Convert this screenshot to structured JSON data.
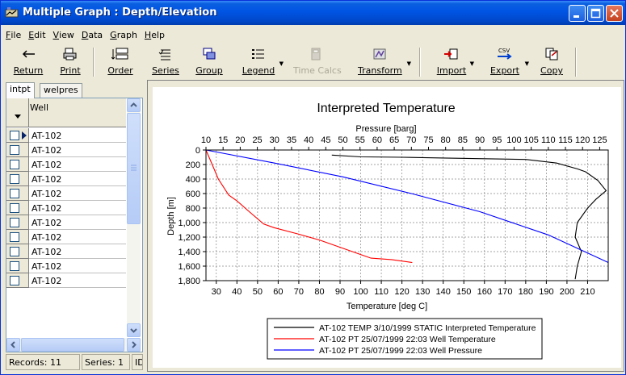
{
  "window": {
    "title": "Multiple Graph : Depth/Elevation"
  },
  "menu": [
    {
      "key": "F",
      "rest": "ile"
    },
    {
      "key": "E",
      "rest": "dit"
    },
    {
      "key": "V",
      "rest": "iew"
    },
    {
      "key": "D",
      "rest": "ata"
    },
    {
      "key": "G",
      "rest": "raph"
    },
    {
      "key": "H",
      "rest": "elp"
    }
  ],
  "toolbar": {
    "return": "Return",
    "print": "Print",
    "order": "Order",
    "series": "Series",
    "group": "Group",
    "legend": "Legend",
    "time_calcs": "Time Calcs",
    "transform": "Transform",
    "import": "Import",
    "export": "Export",
    "copy": "Copy",
    "export_badge": "CSV"
  },
  "tabs": [
    "intpt",
    "welpres"
  ],
  "grid": {
    "column_header": "Well",
    "rows": [
      "AT-102",
      "AT-102",
      "AT-102",
      "AT-102",
      "AT-102",
      "AT-102",
      "AT-102",
      "AT-102",
      "AT-102",
      "AT-102",
      "AT-102"
    ]
  },
  "status": {
    "records": "Records: 11",
    "series": "Series: 1",
    "extra": "ID"
  },
  "chart_data": {
    "type": "line",
    "title": "Interpreted Temperature",
    "top_axis": {
      "label": "Pressure [barg]",
      "range": [
        10,
        127.5
      ],
      "ticks": [
        10,
        15,
        20,
        25,
        30,
        35,
        40,
        45,
        50,
        55,
        60,
        65,
        70,
        75,
        80,
        85,
        90,
        95,
        100,
        105,
        110,
        115,
        120,
        125
      ]
    },
    "bottom_axis": {
      "label": "Temperature [deg C]",
      "range": [
        25,
        220
      ],
      "ticks": [
        30,
        40,
        50,
        60,
        70,
        80,
        90,
        100,
        110,
        120,
        130,
        140,
        150,
        160,
        170,
        180,
        190,
        200,
        210
      ]
    },
    "left_axis": {
      "label": "Depth [m]",
      "range": [
        0,
        1800
      ],
      "inverted": true,
      "ticks": [
        "0",
        "200",
        "400",
        "600",
        "800",
        "1,000",
        "1,200",
        "1,400",
        "1,600",
        "1,800"
      ],
      "tick_values": [
        0,
        200,
        400,
        600,
        800,
        1000,
        1200,
        1400,
        1600,
        1800
      ]
    },
    "grid": true,
    "legend_position": "bottom",
    "series": [
      {
        "name": "AT-102 TEMP 3/10/1999 STATIC Interpreted Temperature",
        "color": "#000000",
        "axis": "temperature",
        "points": [
          [
            86,
            70
          ],
          [
            100,
            95
          ],
          [
            120,
            100
          ],
          [
            140,
            110
          ],
          [
            160,
            120
          ],
          [
            180,
            130
          ],
          [
            195,
            180
          ],
          [
            205,
            260
          ],
          [
            209,
            300
          ],
          [
            215,
            420
          ],
          [
            219,
            560
          ],
          [
            214,
            680
          ],
          [
            210,
            800
          ],
          [
            205,
            1000
          ],
          [
            204,
            1200
          ],
          [
            207,
            1400
          ],
          [
            205,
            1600
          ],
          [
            204,
            1780
          ]
        ]
      },
      {
        "name": "AT-102 PT 25/07/1999 22:03 Well Temperature",
        "color": "#ff0000",
        "axis": "temperature",
        "points": [
          [
            25,
            0
          ],
          [
            28,
            200
          ],
          [
            31,
            400
          ],
          [
            36,
            620
          ],
          [
            40,
            700
          ],
          [
            46,
            850
          ],
          [
            53,
            1020
          ],
          [
            58,
            1070
          ],
          [
            70,
            1160
          ],
          [
            80,
            1240
          ],
          [
            90,
            1340
          ],
          [
            100,
            1440
          ],
          [
            105,
            1490
          ],
          [
            115,
            1510
          ],
          [
            125,
            1550
          ]
        ]
      },
      {
        "name": "AT-102 PT 25/07/1999 22:03 Well Pressure",
        "color": "#0000ff",
        "axis": "pressure",
        "points": [
          [
            10,
            0
          ],
          [
            30,
            180
          ],
          [
            50,
            370
          ],
          [
            70,
            600
          ],
          [
            90,
            850
          ],
          [
            110,
            1170
          ],
          [
            127.5,
            1550
          ]
        ]
      }
    ]
  }
}
